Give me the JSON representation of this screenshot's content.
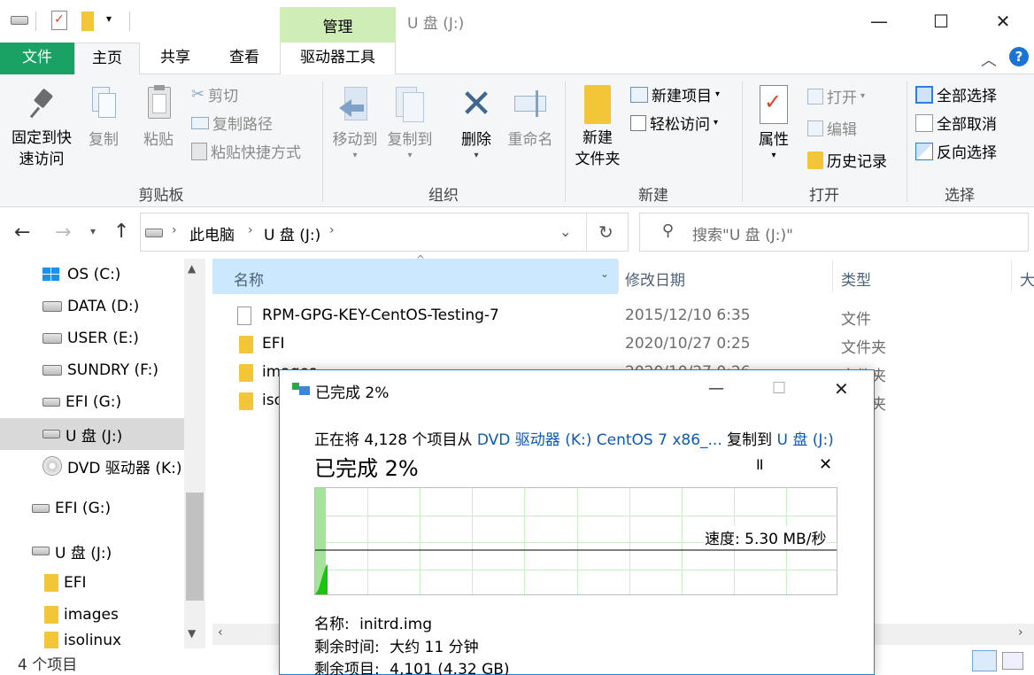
{
  "titlebar": {
    "manage_label": "管理",
    "window_title": "U 盘 (J:)",
    "minimize": "—",
    "maximize": "☐",
    "close": "✕"
  },
  "tabs": {
    "file": "文件",
    "home": "主页",
    "share": "共享",
    "view": "查看",
    "driver_tools": "驱动器工具"
  },
  "ribbon": {
    "clipboard": {
      "pin_line1": "固定到快",
      "pin_line2": "速访问",
      "copy": "复制",
      "paste": "粘贴",
      "cut": "剪切",
      "copy_path": "复制路径",
      "paste_shortcut": "粘贴快捷方式",
      "label": "剪贴板"
    },
    "organize": {
      "move_to": "移动到",
      "copy_to": "复制到",
      "delete": "删除",
      "rename": "重命名",
      "label": "组织"
    },
    "new": {
      "new_folder_line1": "新建",
      "new_folder_line2": "文件夹",
      "new_item": "新建项目",
      "easy_access": "轻松访问",
      "label": "新建"
    },
    "open": {
      "properties": "属性",
      "open": "打开",
      "edit": "编辑",
      "history": "历史记录",
      "label": "打开"
    },
    "select": {
      "select_all": "全部选择",
      "select_none": "全部取消",
      "invert": "反向选择",
      "label": "选择"
    }
  },
  "address": {
    "crumbs": [
      "此电脑",
      "U 盘 (J:)"
    ],
    "search_placeholder": "搜索\"U 盘 (J:)\""
  },
  "nav": {
    "items": [
      {
        "label": "OS (C:)",
        "icon": "windows-drive-icon"
      },
      {
        "label": "DATA (D:)",
        "icon": "drive-icon"
      },
      {
        "label": "USER (E:)",
        "icon": "drive-icon"
      },
      {
        "label": "SUNDRY (F:)",
        "icon": "drive-icon"
      },
      {
        "label": "EFI (G:)",
        "icon": "usb-drive-icon"
      },
      {
        "label": "U 盘 (J:)",
        "icon": "usb-drive-icon"
      },
      {
        "label": "DVD 驱动器 (K:)",
        "icon": "dvd-icon"
      },
      {
        "label": "EFI (G:)",
        "icon": "usb-drive-icon"
      },
      {
        "label": "U 盘 (J:)",
        "icon": "usb-drive-icon"
      },
      {
        "label": "EFI",
        "icon": "folder-icon"
      },
      {
        "label": "images",
        "icon": "folder-icon"
      },
      {
        "label": "isolinux",
        "icon": "folder-icon"
      }
    ]
  },
  "files": {
    "columns": [
      "名称",
      "修改日期",
      "类型",
      "大"
    ],
    "rows": [
      {
        "name": "RPM-GPG-KEY-CentOS-Testing-7",
        "date": "2015/12/10 6:35",
        "type": "文件",
        "icon": "file-icon"
      },
      {
        "name": "EFI",
        "date": "2020/10/27 0:25",
        "type": "文件夹",
        "icon": "folder-icon"
      },
      {
        "name": "images",
        "date": "2020/10/27 0:26",
        "type": "文件夹",
        "icon": "folder-icon"
      },
      {
        "name": "isolinux",
        "date": "",
        "type": "文件夹",
        "icon": "folder-icon"
      }
    ]
  },
  "status": {
    "count": "4 个项目"
  },
  "dialog": {
    "title": "已完成 2%",
    "copy_prefix": "正在将 4,128 个项目从",
    "source": "DVD 驱动器 (K:) CentOS 7 x86_...",
    "copy_mid": "复制到",
    "dest": "U 盘 (J:)",
    "progress_heading": "已完成 2%",
    "pause": "II",
    "cancel": "✕",
    "speed": "速度: 5.30 MB/秒",
    "progress_fraction": 0.02,
    "name_label": "名称:",
    "name_value": "initrd.img",
    "time_label": "剩余时间:",
    "time_value": "大约 11 分钟",
    "items_label": "剩余项目:",
    "items_value": "4,101 (4.32 GB)"
  },
  "colors": {
    "file_tab": "#19a263",
    "manage_tab": "#cfeeb6",
    "link": "#0b59b8",
    "progress_fill": "#16c60c"
  }
}
